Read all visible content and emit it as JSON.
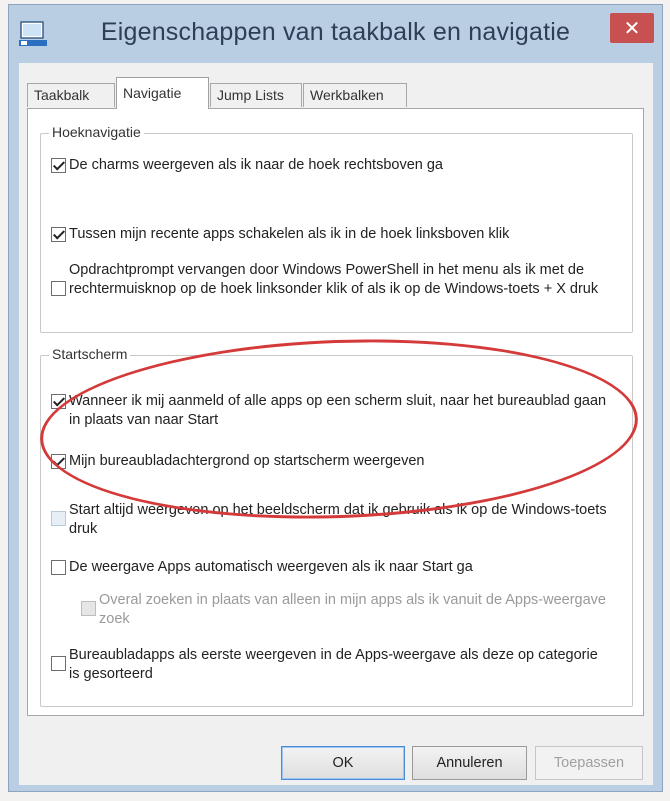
{
  "window": {
    "title": "Eigenschappen van taakbalk en navigatie",
    "close_glyph": "✕"
  },
  "tabs": [
    {
      "label": "Taakbalk"
    },
    {
      "label": "Navigatie",
      "active": true
    },
    {
      "label": "Jump Lists"
    },
    {
      "label": "Werkbalken"
    }
  ],
  "groups": {
    "corner": {
      "title": "Hoeknavigatie",
      "items": [
        {
          "label": "De charms weergeven als ik naar de hoek rechtsboven ga",
          "checked": true
        },
        {
          "label": "Tussen mijn recente apps schakelen als ik in de hoek linksboven klik",
          "checked": true
        },
        {
          "label": "Opdrachtprompt vervangen door Windows PowerShell in het menu als ik met de rechtermuisknop op de hoek linksonder klik of als ik op de Windows-toets + X druk",
          "checked": false
        }
      ]
    },
    "start": {
      "title": "Startscherm",
      "items": [
        {
          "label": "Wanneer ik mij aanmeld of alle apps op een scherm sluit, naar het bureaublad gaan in plaats van naar Start",
          "checked": true
        },
        {
          "label": "Mijn bureaubladachtergrond op startscherm weergeven",
          "checked": true
        },
        {
          "label": "Start altijd weergeven op het beeldscherm dat ik gebruik als ik op de Windows-toets druk",
          "checked": false,
          "disabled": true
        },
        {
          "label": "De weergave Apps automatisch weergeven als ik naar Start ga",
          "checked": false
        },
        {
          "label": "Overal zoeken in plaats van alleen in mijn apps als ik vanuit de Apps-weergave zoek",
          "checked": false,
          "disabled": true
        },
        {
          "label": "Bureaubladapps als eerste weergeven in de Apps-weergave als deze op categorie is gesorteerd",
          "checked": false
        }
      ]
    }
  },
  "buttons": {
    "ok": "OK",
    "cancel": "Annuleren",
    "apply": "Toepassen"
  },
  "colors": {
    "titlebar": "#b9cde3",
    "close": "#c75050",
    "annotation_circle": "#d43a3a"
  }
}
